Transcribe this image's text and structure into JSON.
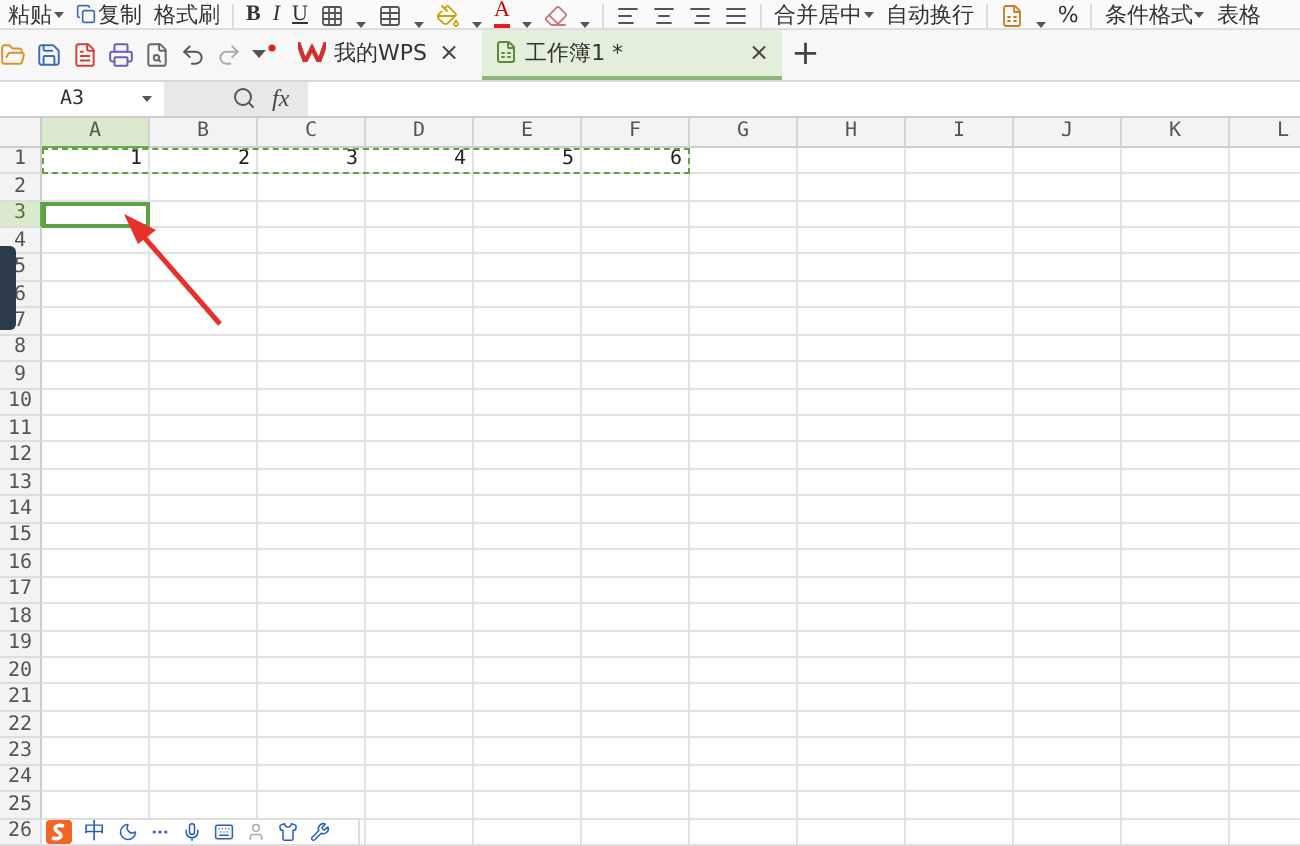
{
  "ribbon": {
    "clipboard": [
      {
        "label": "粘贴",
        "caret": true
      },
      {
        "label": "复制",
        "caret": false
      },
      {
        "label": "格式刷",
        "caret": false
      }
    ],
    "font_styles": [
      "B",
      "I",
      "U"
    ],
    "font_color": "A",
    "merge": [
      {
        "label": "合并居中",
        "caret": true
      },
      {
        "label": "自动换行",
        "caret": false
      }
    ],
    "percent": "%",
    "styles": [
      {
        "label": "条件格式",
        "caret": true
      },
      {
        "label": "表格",
        "caret": false
      }
    ]
  },
  "tabs": [
    {
      "label": "我的WPS",
      "selected": false,
      "close": "×"
    },
    {
      "label": "工作簿1 *",
      "selected": true,
      "close": "×"
    }
  ],
  "new_tab": "+",
  "formula_bar": {
    "name_box": "A3",
    "fx": "fx"
  },
  "columns": [
    {
      "label": "A",
      "selected": true
    },
    {
      "label": "B",
      "selected": false
    },
    {
      "label": "C",
      "selected": false
    },
    {
      "label": "D",
      "selected": false
    },
    {
      "label": "E",
      "selected": false
    },
    {
      "label": "F",
      "selected": false
    },
    {
      "label": "G",
      "selected": false
    },
    {
      "label": "H",
      "selected": false
    },
    {
      "label": "I",
      "selected": false
    },
    {
      "label": "J",
      "selected": false
    },
    {
      "label": "K",
      "selected": false
    },
    {
      "label": "L",
      "selected": false
    }
  ],
  "rows": [
    {
      "label": "1",
      "selected": false,
      "copied": true,
      "cells": [
        "1",
        "2",
        "3",
        "4",
        "5",
        "6"
      ]
    },
    {
      "label": "2",
      "selected": false,
      "copied": false,
      "cells": []
    },
    {
      "label": "3",
      "selected": true,
      "copied": false,
      "cells": []
    },
    {
      "label": "4",
      "selected": false,
      "copied": false,
      "cells": []
    },
    {
      "label": "5",
      "selected": false,
      "copied": false,
      "cells": []
    },
    {
      "label": "6",
      "selected": false,
      "copied": false,
      "cells": []
    },
    {
      "label": "7",
      "selected": false,
      "copied": false,
      "cells": []
    },
    {
      "label": "8",
      "selected": false,
      "copied": false,
      "cells": []
    },
    {
      "label": "9",
      "selected": false,
      "copied": false,
      "cells": []
    },
    {
      "label": "10",
      "selected": false,
      "copied": false,
      "cells": []
    },
    {
      "label": "11",
      "selected": false,
      "copied": false,
      "cells": []
    },
    {
      "label": "12",
      "selected": false,
      "copied": false,
      "cells": []
    },
    {
      "label": "13",
      "selected": false,
      "copied": false,
      "cells": []
    },
    {
      "label": "14",
      "selected": false,
      "copied": false,
      "cells": []
    },
    {
      "label": "15",
      "selected": false,
      "copied": false,
      "cells": []
    },
    {
      "label": "16",
      "selected": false,
      "copied": false,
      "cells": []
    },
    {
      "label": "17",
      "selected": false,
      "copied": false,
      "cells": []
    },
    {
      "label": "18",
      "selected": false,
      "copied": false,
      "cells": []
    },
    {
      "label": "19",
      "selected": false,
      "copied": false,
      "cells": []
    },
    {
      "label": "20",
      "selected": false,
      "copied": false,
      "cells": []
    },
    {
      "label": "21",
      "selected": false,
      "copied": false,
      "cells": []
    },
    {
      "label": "22",
      "selected": false,
      "copied": false,
      "cells": []
    },
    {
      "label": "23",
      "selected": false,
      "copied": false,
      "cells": []
    },
    {
      "label": "24",
      "selected": false,
      "copied": false,
      "cells": []
    },
    {
      "label": "25",
      "selected": false,
      "copied": false,
      "cells": []
    },
    {
      "label": "26",
      "selected": false,
      "copied": false,
      "cells": []
    }
  ],
  "ime_toolbar": {
    "mode": "中"
  }
}
